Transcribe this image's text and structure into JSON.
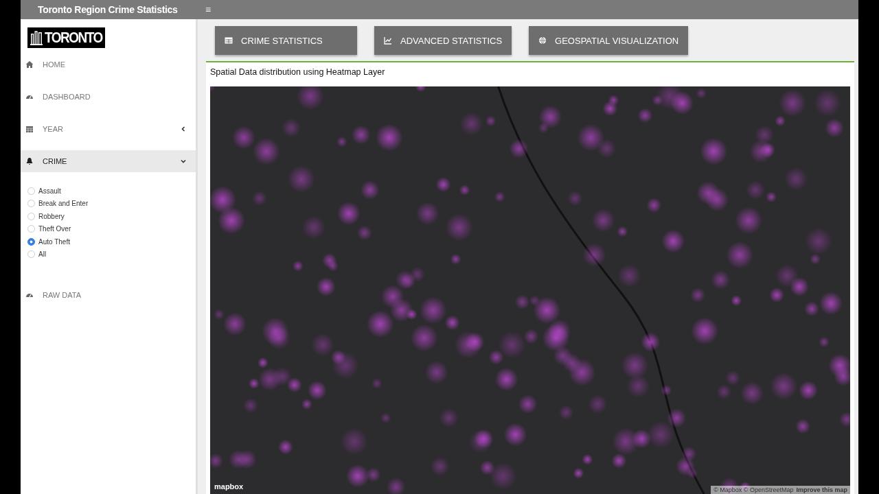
{
  "header": {
    "title": "Toronto Region Crime Statistics",
    "menu_icon": "≡"
  },
  "sidebar": {
    "logo": "TORONTO",
    "items": [
      {
        "label": "HOME",
        "kind": "link",
        "selected": false
      },
      {
        "label": "DASHBOARD",
        "kind": "link",
        "selected": false
      },
      {
        "label": "YEAR",
        "kind": "group",
        "expanded": false,
        "selected": false
      },
      {
        "label": "CRIME",
        "kind": "group",
        "expanded": true,
        "selected": true,
        "options": [
          {
            "label": "Assault",
            "selected": false
          },
          {
            "label": "Break and Enter",
            "selected": false
          },
          {
            "label": "Robbery",
            "selected": false
          },
          {
            "label": "Theft Over",
            "selected": false
          },
          {
            "label": "Auto Theft",
            "selected": true
          },
          {
            "label": "All",
            "selected": false
          }
        ]
      },
      {
        "label": "RAW DATA",
        "kind": "link",
        "selected": false
      }
    ]
  },
  "tabs": [
    {
      "label": "CRIME STATISTICS"
    },
    {
      "label": "ADVANCED STATISTICS"
    },
    {
      "label": "GEOSPATIAL VISUALIZATION"
    }
  ],
  "panel": {
    "title": "Spatial Data distribution using Heatmap Layer",
    "map": {
      "logo": "mapbox",
      "attribution": "© Mapbox © OpenStreetMap",
      "improve_link": "Improve this map"
    }
  }
}
